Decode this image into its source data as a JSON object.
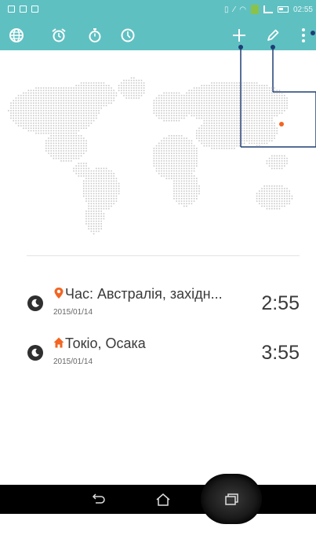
{
  "status_bar": {
    "time": "02:55",
    "percent": "°;l"
  },
  "action_bar": {
    "tabs": [
      {
        "name": "world-clock-tab",
        "icon": "globe-icon"
      },
      {
        "name": "alarm-tab",
        "icon": "alarm-clock-icon"
      },
      {
        "name": "stopwatch-tab",
        "icon": "stopwatch-icon"
      },
      {
        "name": "timer-tab",
        "icon": "timer-icon"
      }
    ],
    "actions": [
      {
        "name": "add-city-button",
        "icon": "plus-icon"
      },
      {
        "name": "edit-button",
        "icon": "pencil-icon"
      },
      {
        "name": "overflow-menu-button",
        "icon": "more-vert-icon"
      }
    ],
    "accent_color": "#5fc0c2"
  },
  "clocks": [
    {
      "city": "Час: Австралія, західн...",
      "date": "2015/01/14",
      "time": "2:55",
      "place_icon": "location-pin-icon",
      "place_color": "#f26522"
    },
    {
      "city": "Токіо, Осака",
      "date": "2015/01/14",
      "time": "3:55",
      "place_icon": "home-icon",
      "place_color": "#f26522"
    }
  ],
  "nav_bar": {
    "buttons": [
      "back-icon",
      "home-icon",
      "recent-apps-icon"
    ]
  }
}
